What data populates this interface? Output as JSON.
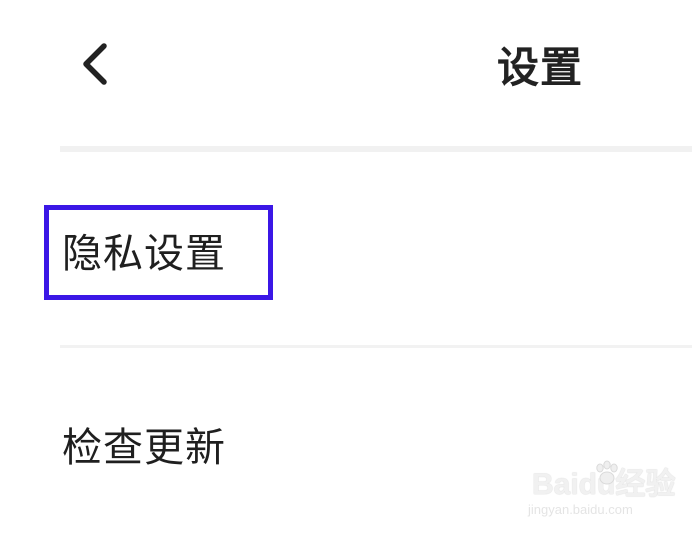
{
  "header": {
    "back_icon": "chevron-left-icon",
    "title": "设置"
  },
  "settings_list": {
    "items": [
      {
        "label": "隐私设置",
        "highlighted": true
      },
      {
        "label": "检查更新",
        "highlighted": false
      }
    ]
  },
  "annotation": {
    "highlight_color": "#3b17e6"
  },
  "watermark": {
    "logo": "Baidu经验",
    "url": "jingyan.baidu.com"
  },
  "colors": {
    "background": "#ffffff",
    "text": "#1f1f1f",
    "divider": "#f1f1f1"
  }
}
